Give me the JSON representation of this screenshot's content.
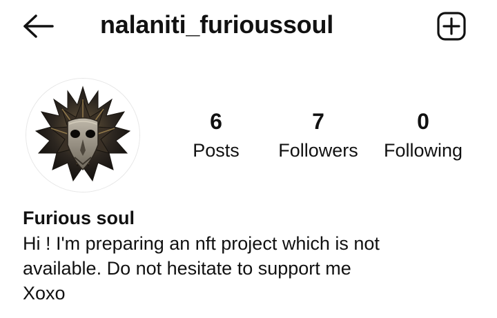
{
  "header": {
    "username": "nalaniti_furioussoul",
    "back_icon": "arrow-left-icon",
    "new_post_icon": "plus-square-icon"
  },
  "profile": {
    "avatar_description_icon": "avatar-mask-image",
    "stats": [
      {
        "value": "6",
        "label": "Posts"
      },
      {
        "value": "7",
        "label": "Followers"
      },
      {
        "value": "0",
        "label": "Following"
      }
    ]
  },
  "bio": {
    "name": "Furious soul",
    "lines": [
      "Hi ! I'm preparing an nft project which is not",
      "available. Do not hesitate to support me",
      "Xoxo"
    ]
  },
  "colors": {
    "text": "#111111",
    "background": "#ffffff"
  }
}
